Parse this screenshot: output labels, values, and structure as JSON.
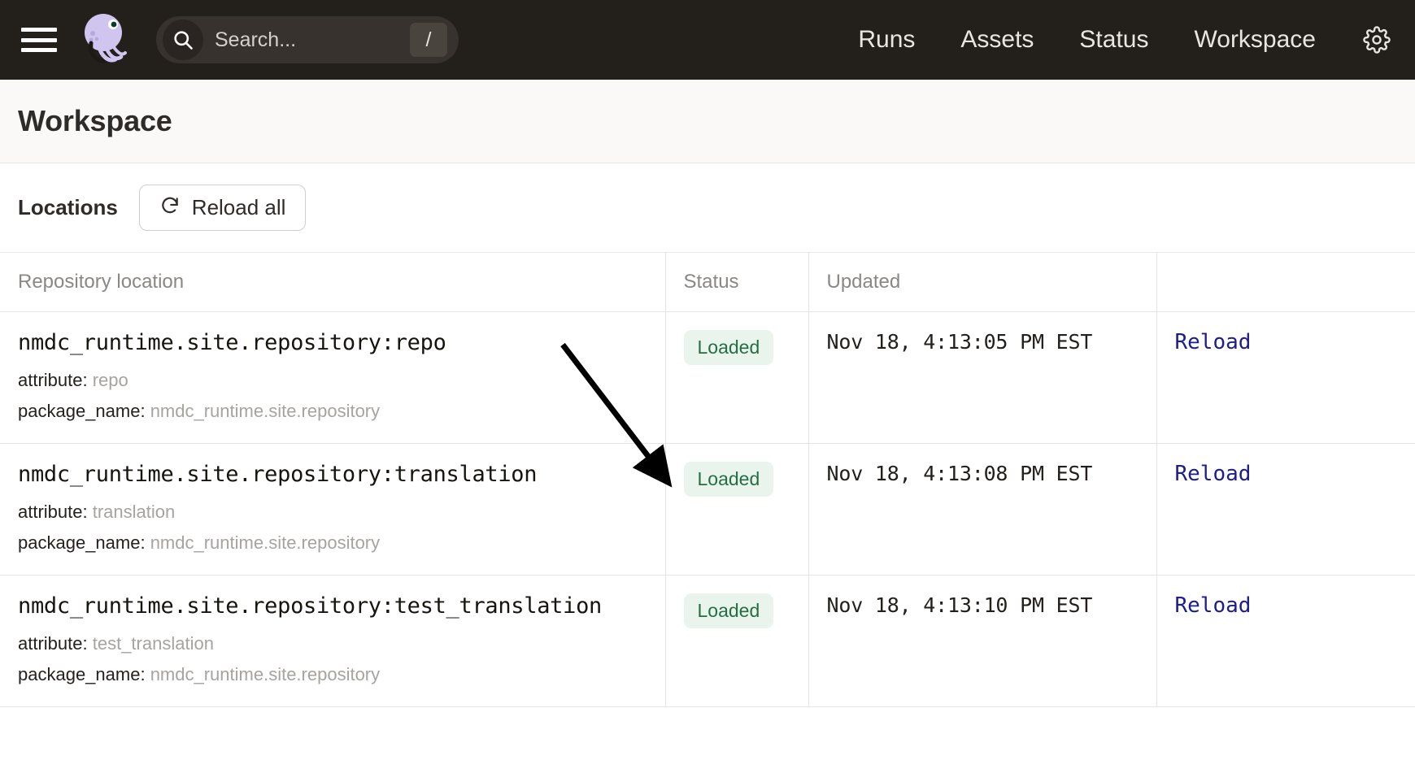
{
  "topbar": {
    "menu_icon": "hamburger-menu-icon",
    "logo_icon": "dagster-octopus-logo",
    "search": {
      "placeholder": "Search...",
      "value": "",
      "icon": "search-icon",
      "shortcut_key": "/"
    },
    "nav_links": [
      {
        "label": "Runs"
      },
      {
        "label": "Assets"
      },
      {
        "label": "Status"
      },
      {
        "label": "Workspace"
      }
    ],
    "settings_icon": "gear-icon"
  },
  "page": {
    "title": "Workspace"
  },
  "toolbar": {
    "locations_label": "Locations",
    "reload_all_label": "Reload all",
    "reload_icon": "refresh-icon"
  },
  "table": {
    "headers": {
      "repository_location": "Repository location",
      "status": "Status",
      "updated": "Updated",
      "action": ""
    },
    "rows": [
      {
        "name": "nmdc_runtime.site.repository:repo",
        "attribute_label": "attribute:",
        "attribute_value": "repo",
        "package_label": "package_name:",
        "package_value": "nmdc_runtime.site.repository",
        "status": "Loaded",
        "updated": "Nov 18, 4:13:05 PM EST",
        "action": "Reload"
      },
      {
        "name": "nmdc_runtime.site.repository:translation",
        "attribute_label": "attribute:",
        "attribute_value": "translation",
        "package_label": "package_name:",
        "package_value": "nmdc_runtime.site.repository",
        "status": "Loaded",
        "updated": "Nov 18, 4:13:08 PM EST",
        "action": "Reload"
      },
      {
        "name": "nmdc_runtime.site.repository:test_translation",
        "attribute_label": "attribute:",
        "attribute_value": "test_translation",
        "package_label": "package_name:",
        "package_value": "nmdc_runtime.site.repository",
        "status": "Loaded",
        "updated": "Nov 18, 4:13:10 PM EST",
        "action": "Reload"
      }
    ]
  },
  "annotation": {
    "arrow": "pointer-arrow"
  },
  "colors": {
    "topbar_bg": "#231f1b",
    "status_badge_bg": "#e9f4ed",
    "status_badge_text": "#256e43",
    "link": "#1d1d8e",
    "page_header_bg": "#faf9f8"
  }
}
